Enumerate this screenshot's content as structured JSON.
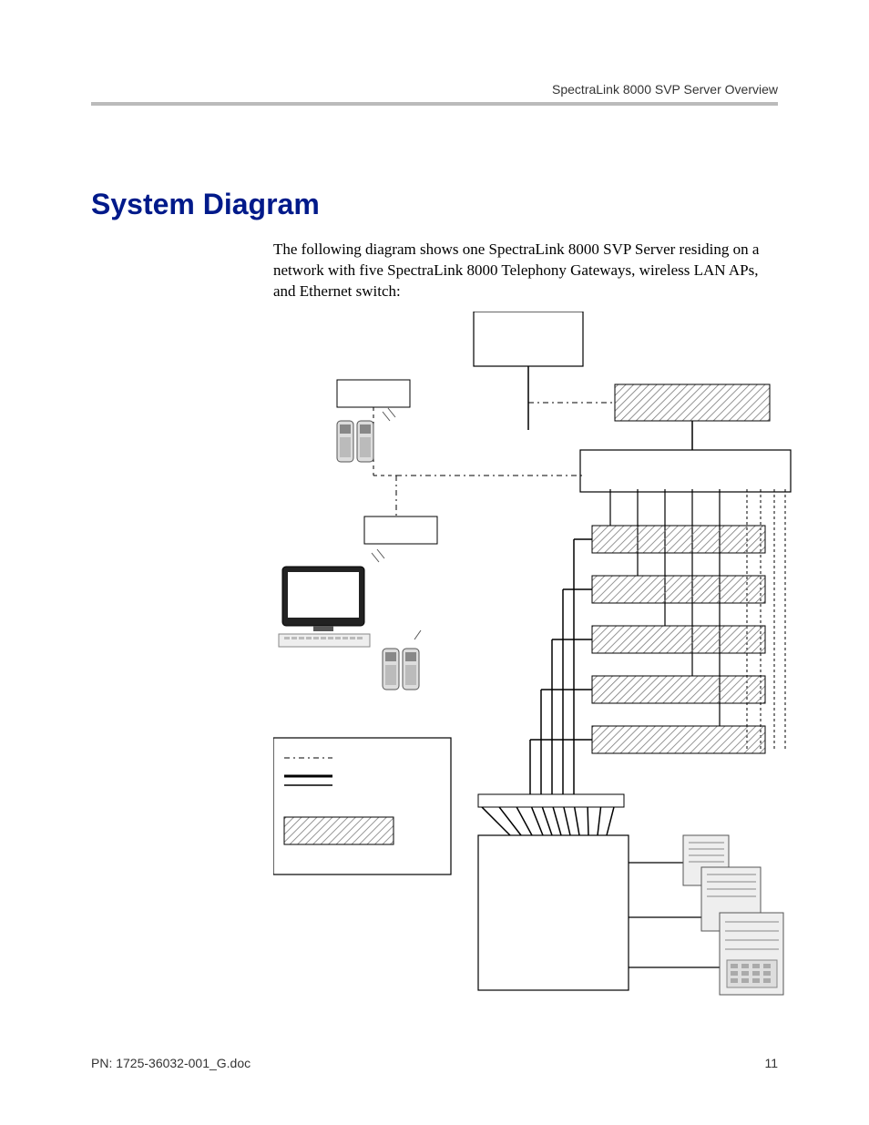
{
  "header": {
    "right": "SpectraLink 8000 SVP Server Overview"
  },
  "title": "System Diagram",
  "intro": "The following diagram shows one SpectraLink 8000 SVP Server residing on a network with five SpectraLink 8000 Telephony Gateways, wireless LAN APs, and Ethernet switch:",
  "footer": {
    "doc": "PN: 1725-36032-001_G.doc",
    "page": "11"
  }
}
